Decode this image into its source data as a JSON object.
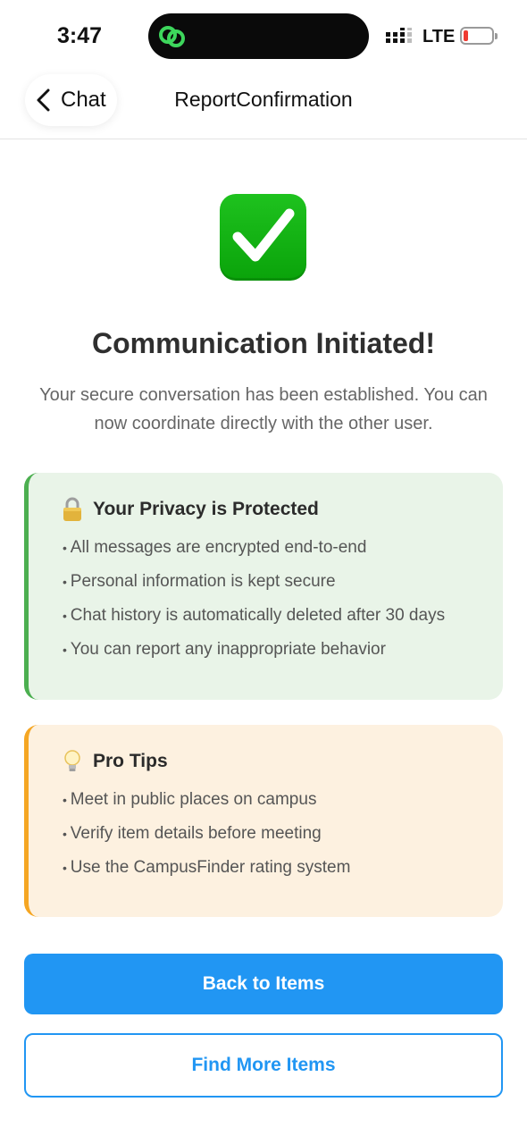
{
  "status_bar": {
    "time": "3:47",
    "network": "LTE",
    "icons": [
      "link-icon",
      "signal-icon",
      "battery-icon"
    ]
  },
  "nav": {
    "back_label": "Chat",
    "title": "ReportConfirmation"
  },
  "confirmation": {
    "icon": "check-mark-icon",
    "headline": "Communication Initiated!",
    "subtext": "Your secure conversation has been established. You can now coordinate directly with the other user."
  },
  "privacy_card": {
    "icon": "lock-icon",
    "title": "Your Privacy is Protected",
    "items": [
      "All messages are encrypted end-to-end",
      "Personal information is kept secure",
      "Chat history is automatically deleted after 30 days",
      "You can report any inappropriate behavior"
    ]
  },
  "tips_card": {
    "icon": "lightbulb-icon",
    "title": "Pro Tips",
    "items": [
      "Meet in public places on campus",
      "Verify item details before meeting",
      "Use the CampusFinder rating system"
    ]
  },
  "actions": {
    "primary_label": "Back to Items",
    "secondary_label": "Find More Items"
  },
  "colors": {
    "accent": "#2196f3",
    "success": "#4caf50",
    "warning": "#f5a623",
    "check_green": "#0aa30a"
  }
}
